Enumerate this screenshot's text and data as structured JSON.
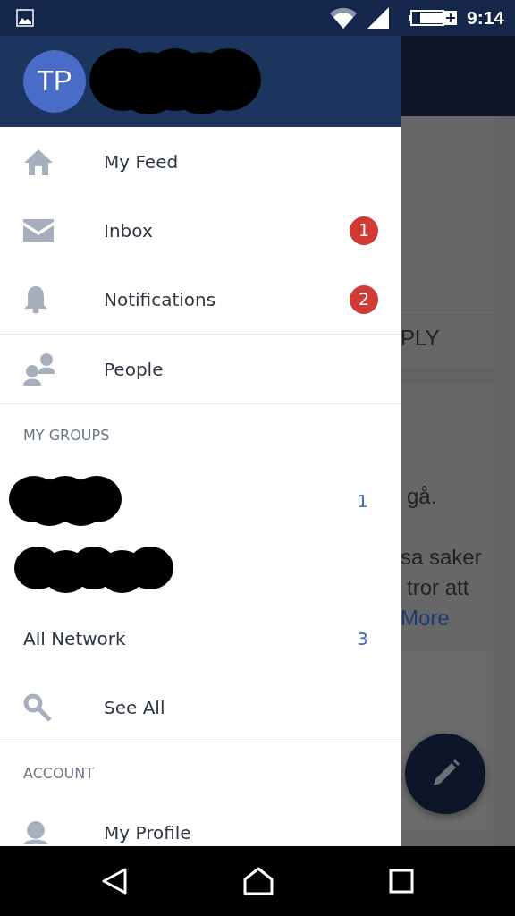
{
  "status_bar": {
    "time": "9:14"
  },
  "drawer": {
    "header": {
      "initials": "TP"
    },
    "main_items": [
      {
        "kind": "home",
        "label": "My Feed"
      },
      {
        "kind": "mail",
        "label": "Inbox",
        "badge": "1"
      },
      {
        "kind": "bell",
        "label": "Notifications",
        "badge": "2"
      }
    ],
    "secondary_items": [
      {
        "kind": "people",
        "label": "People"
      }
    ],
    "groups": {
      "heading": "MY GROUPS",
      "items": [
        {
          "kind": "redacted",
          "count": "1"
        },
        {
          "kind": "redacted"
        },
        {
          "kind": "named",
          "label": "All Network",
          "count": "3"
        }
      ]
    },
    "see_all": {
      "kind": "search",
      "label": "See All"
    },
    "account": {
      "heading": "ACCOUNT",
      "items": [
        {
          "kind": "person",
          "label": "My Profile"
        }
      ]
    }
  },
  "background_feed": {
    "action": "PLY",
    "lines": [
      "gå.",
      "sa saker",
      "tror att"
    ],
    "link": "More"
  }
}
